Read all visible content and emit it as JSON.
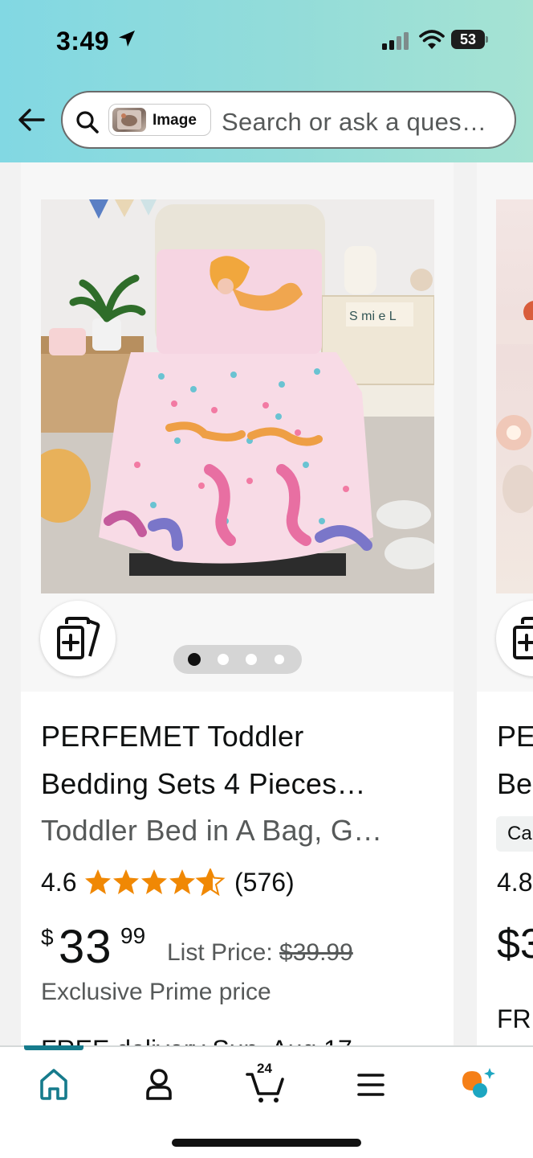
{
  "status_bar": {
    "time": "3:49",
    "battery": "53"
  },
  "search": {
    "image_chip_label": "Image",
    "placeholder": "Search or ask a ques…"
  },
  "product": {
    "title_line1": "PERFEMET Toddler",
    "title_line2": "Bedding Sets 4 Pieces…",
    "subtitle": "Toddler Bed in A Bag, G…",
    "rating": "4.6",
    "rating_stars": 4.6,
    "rating_count": "(576)",
    "price_symbol": "$",
    "price_whole": "33",
    "price_fraction": "99",
    "list_price_label": "List Price: ",
    "list_price": "$39.99",
    "prime_note": "Exclusive Prime price",
    "delivery_peek": "FREE delivery Sun, Aug 17",
    "image_dots": 4,
    "active_dot": 0,
    "image_text": "S mi e L"
  },
  "next_product": {
    "title_line1": "PE",
    "title_line2": "Be",
    "badge": "Ca",
    "rating": "4.8",
    "price_peek": "$3",
    "delivery_peek": "FRE"
  },
  "bottom_nav": {
    "cart_count": "24"
  },
  "colors": {
    "header_gradient_start": "#82d8e3",
    "header_gradient_end": "#a6e3d3",
    "star": "#f08804",
    "nav_active": "#167b8c",
    "rufus_orange": "#f57f17",
    "rufus_teal": "#1da6c1"
  }
}
